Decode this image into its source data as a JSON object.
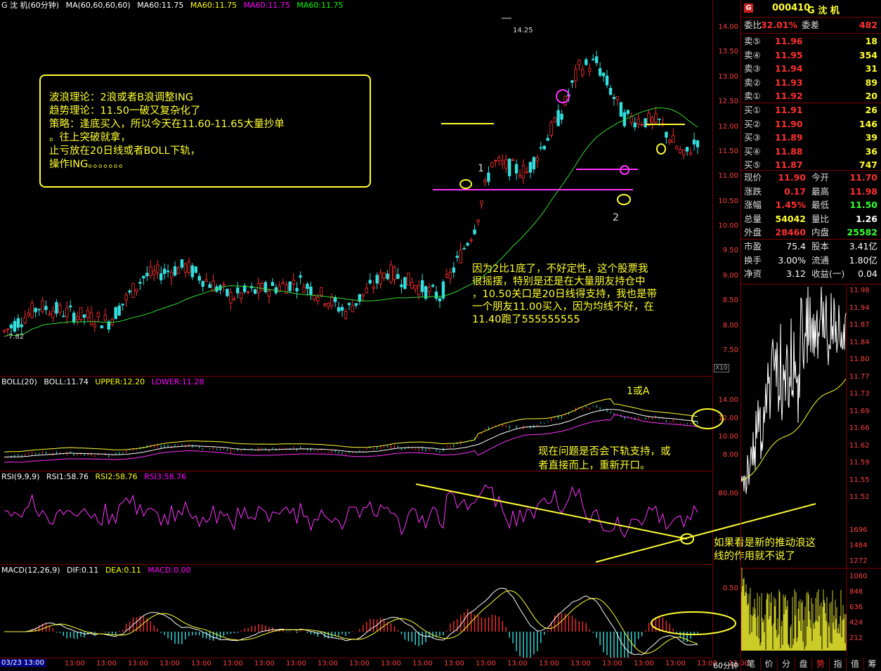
{
  "header": {
    "name": "G 沈  机(60分钟)",
    "ma_label": "MA(60,60,60,60)",
    "ma": [
      "MA60:11.75",
      "MA60:11.75",
      "MA60:11.75",
      "MA60:11.75"
    ],
    "ma_colors": [
      "#ffffff",
      "#ffff00",
      "#ff00ff",
      "#00ff00"
    ]
  },
  "price_axis": [
    "14.00",
    "13.50",
    "13.00",
    "12.50",
    "12.00",
    "11.50",
    "11.00",
    "10.50",
    "10.00",
    "9.50",
    "9.00",
    "8.50",
    "8.00",
    "7.50"
  ],
  "price_high_label": "14.25",
  "price_low_label": "7.82",
  "x10_label": "X10",
  "boll": {
    "label": "BOLL(20)",
    "mid": "BOLL:11.74",
    "upper": "UPPER:12.20",
    "lower": "LOWER:11.28",
    "axis": [
      "14.00",
      "12.00",
      "10.00",
      "8.00"
    ]
  },
  "rsi": {
    "label": "RSI(9,9,9)",
    "r1": "RSI1:58.76",
    "r2": "RSI2:58.76",
    "r3": "RSI3:58.76",
    "axis": [
      "80.00"
    ]
  },
  "macd": {
    "label": "MACD(12,26,9)",
    "dif": "DIF:0.11",
    "dea": "DEA:0.11",
    "macd": "MACD:0.00",
    "axis": [
      "0.50"
    ]
  },
  "x_axis": {
    "first": "03/23 13:00",
    "ticks": [
      "13:00",
      "13:00",
      "13:00",
      "13:00",
      "13:00",
      "13:00",
      "13:00",
      "13:00",
      "13:00",
      "13:00",
      "13:00",
      "13:00",
      "13:00",
      "13:00",
      "13:00",
      "13:00",
      "13:00",
      "13:00",
      "13:00",
      "13:00",
      "13:00",
      "13:00"
    ],
    "period": "60分钟"
  },
  "annotations": {
    "box": "波浪理论：2浪或者B浪调整ING\n趋势理论：11.50一破又复杂化了\n策略：逢底买入，所以今天在11.60-11.65大量抄单\n。往上突破就拿，\n止亏放在20日线或者BOLL下轨，\n操作ING。。。。。。。",
    "middle": "因为2比1底了，不好定性，这个股票我\n很摇摆，特别是还是在大量朋友持仓中\n，10.50关口是20日线得支持，我也是带\n一个朋友11.00买入，因为均线不好，在\n11.40跑了555555555",
    "boll_note": "现在问题是否会下轨支持，或\n者直接而上，重新开口。",
    "wave_1a": "1或A",
    "rsi_note": "如果看是新的推动浪这\n线的作用就不说了",
    "label1": "1",
    "label2": "2"
  },
  "quote": {
    "code": "000410",
    "name": "G 沈  机",
    "weibi_label": "委比",
    "weibi": "32.01%",
    "weicha_label": "委差",
    "weicha": "482",
    "sells": [
      {
        "label": "卖⑤",
        "price": "11.96",
        "vol": "18"
      },
      {
        "label": "卖④",
        "price": "11.95",
        "vol": "354"
      },
      {
        "label": "卖③",
        "price": "11.94",
        "vol": "31"
      },
      {
        "label": "卖②",
        "price": "11.93",
        "vol": "89"
      },
      {
        "label": "卖①",
        "price": "11.92",
        "vol": "20"
      }
    ],
    "buys": [
      {
        "label": "买①",
        "price": "11.91",
        "vol": "26"
      },
      {
        "label": "买②",
        "price": "11.90",
        "vol": "146"
      },
      {
        "label": "买③",
        "price": "11.89",
        "vol": "39"
      },
      {
        "label": "买④",
        "price": "11.88",
        "vol": "36"
      },
      {
        "label": "买⑤",
        "price": "11.87",
        "vol": "747"
      }
    ],
    "stats": [
      {
        "l": "现价",
        "v": "11.90",
        "c": "#ff3030",
        "l2": "今开",
        "v2": "11.70",
        "c2": "#ff3030"
      },
      {
        "l": "涨跌",
        "v": "0.17",
        "c": "#ff3030",
        "l2": "最高",
        "v2": "11.98",
        "c2": "#ff3030"
      },
      {
        "l": "涨幅",
        "v": "1.45%",
        "c": "#ff3030",
        "l2": "最低",
        "v2": "11.50",
        "c2": "#33ff33"
      },
      {
        "l": "总量",
        "v": "54042",
        "c": "#ffff33",
        "l2": "量比",
        "v2": "1.26",
        "c2": "#ffffff"
      },
      {
        "l": "外盘",
        "v": "28460",
        "c": "#ff3030",
        "l2": "内盘",
        "v2": "25582",
        "c2": "#33ff33"
      }
    ],
    "stats2": [
      {
        "l": "市盈",
        "v": "75.4",
        "l2": "股本",
        "v2": "3.41亿"
      },
      {
        "l": "换手",
        "v": "3.00%",
        "l2": "流通",
        "v2": "1.80亿"
      },
      {
        "l": "净资",
        "v": "3.12",
        "l2": "收益(一)",
        "v2": "0.04"
      }
    ],
    "intraday_axis": [
      "11.98",
      "11.94",
      "11.87",
      "11.84",
      "11.80",
      "11.77",
      "11.73",
      "11.69",
      "11.66",
      "11.62",
      "11.59",
      "11.55",
      "11.52"
    ],
    "vol_axis": [
      "1696",
      "1484",
      "1272",
      "1060",
      "848",
      "636",
      "424",
      "212"
    ],
    "tabs": [
      "笔",
      "价",
      "分",
      "盘",
      "势",
      "指",
      "值",
      "筹"
    ]
  },
  "chart_data": {
    "type": "candlestick",
    "ylim": [
      7.5,
      14.25
    ],
    "high": 14.25,
    "low": 7.82,
    "indicators": [
      "BOLL(20)",
      "RSI(9,9,9)",
      "MACD(12,26,9)"
    ]
  }
}
